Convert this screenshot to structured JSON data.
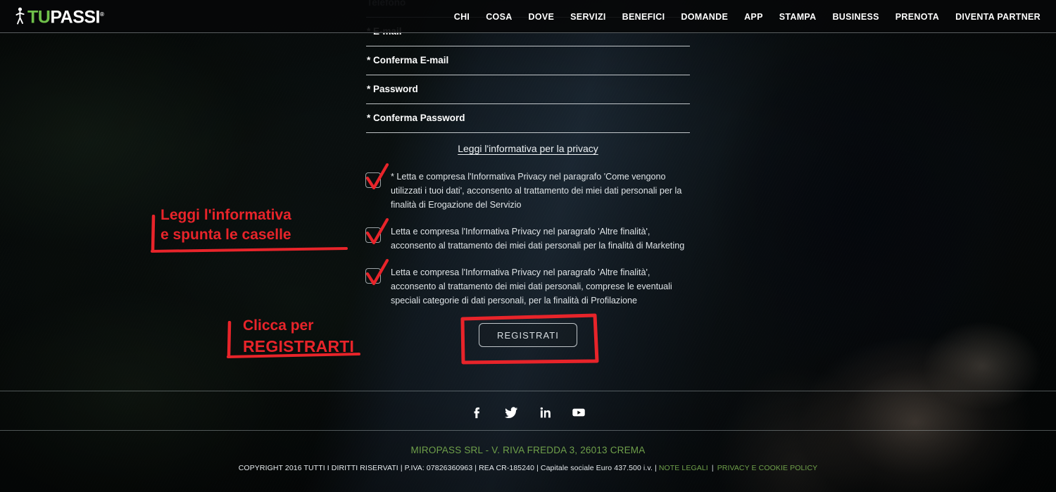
{
  "header": {
    "logo": {
      "icon": "walking-person-icon",
      "text_primary": "TU",
      "text_secondary": "PASSI",
      "trademark": "®",
      "color_primary": "#6fc04a",
      "color_secondary": "#ffffff"
    },
    "nav_items": [
      {
        "label": "CHI"
      },
      {
        "label": "COSA"
      },
      {
        "label": "DOVE"
      },
      {
        "label": "SERVIZI"
      },
      {
        "label": "BENEFICI"
      },
      {
        "label": "DOMANDE"
      },
      {
        "label": "APP"
      },
      {
        "label": "STAMPA"
      },
      {
        "label": "BUSINESS"
      },
      {
        "label": "PRENOTA"
      },
      {
        "label": "DIVENTA PARTNER"
      }
    ]
  },
  "form": {
    "fields": [
      {
        "label": "Telefono",
        "value": "",
        "required": false
      },
      {
        "label": "* E-mail",
        "value": "",
        "required": true
      },
      {
        "label": "* Conferma E-mail",
        "value": "",
        "required": true
      },
      {
        "label": "* Password",
        "value": "",
        "required": true
      },
      {
        "label": "* Conferma Password",
        "value": "",
        "required": true
      }
    ],
    "privacy_link": "Leggi l'informativa per la privacy",
    "consents": [
      {
        "checked": true,
        "text": "* Letta e compresa l'Informativa Privacy nel paragrafo 'Come vengono utilizzati i tuoi dati', acconsento al trattamento dei miei dati personali per la finalità di Erogazione del Servizio"
      },
      {
        "checked": true,
        "text": "Letta e compresa l'Informativa Privacy nel paragrafo 'Altre finalità', acconsento al trattamento dei miei dati personali per la finalità di Marketing"
      },
      {
        "checked": true,
        "text": "Letta e compresa l'Informativa Privacy nel paragrafo 'Altre finalità', acconsento al trattamento dei miei dati personali, comprese le eventuali speciali categorie di dati personali, per la finalità di Profilazione"
      }
    ],
    "submit_label": "REGISTRATI"
  },
  "annotations": {
    "color": "#e8242a",
    "consent_hint_line1": "Leggi l'informativa",
    "consent_hint_line2": "e spunta le caselle",
    "submit_hint_line1": "Clicca per",
    "submit_hint_line2": "REGISTRARTI"
  },
  "footer": {
    "social": [
      {
        "name": "facebook-icon",
        "glyph": "f"
      },
      {
        "name": "twitter-icon",
        "glyph": "t"
      },
      {
        "name": "linkedin-icon",
        "glyph": "in"
      },
      {
        "name": "youtube-icon",
        "glyph": "yt"
      }
    ],
    "company": "MIROPASS SRL - V. RIVA FREDDA 3, 26013 CREMA",
    "legal_text": "COPYRIGHT 2016 TUTTI I DIRITTI RISERVATI | P.IVA: 07826360963 | REA CR-185240 | Capitale sociale Euro 437.500 i.v. |",
    "legal_link_1": "NOTE LEGALI",
    "legal_separator": "|",
    "legal_link_2": "PRIVACY E COOKIE POLICY",
    "link_color": "#6fa04a"
  }
}
